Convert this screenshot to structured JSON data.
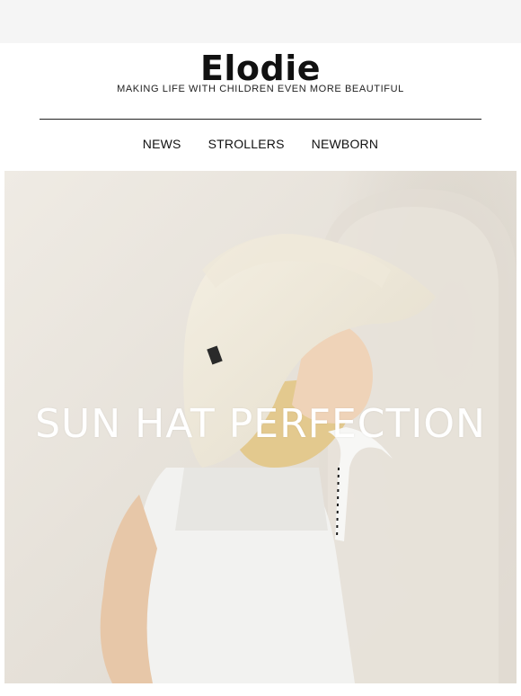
{
  "brand": {
    "logo": "Elodie",
    "tagline": "MAKING LIFE WITH CHILDREN EVEN MORE BEAUTIFUL"
  },
  "nav": {
    "items": [
      {
        "label": "NEWS"
      },
      {
        "label": "STROLLERS"
      },
      {
        "label": "NEWBORN"
      }
    ]
  },
  "hero": {
    "title": "SUN HAT PERFECTION",
    "image_alt": "hero-photo"
  },
  "colors": {
    "background": "#ffffff",
    "top_band": "#f5f5f5",
    "text": "#111111",
    "hero_text": "#ffffff"
  }
}
